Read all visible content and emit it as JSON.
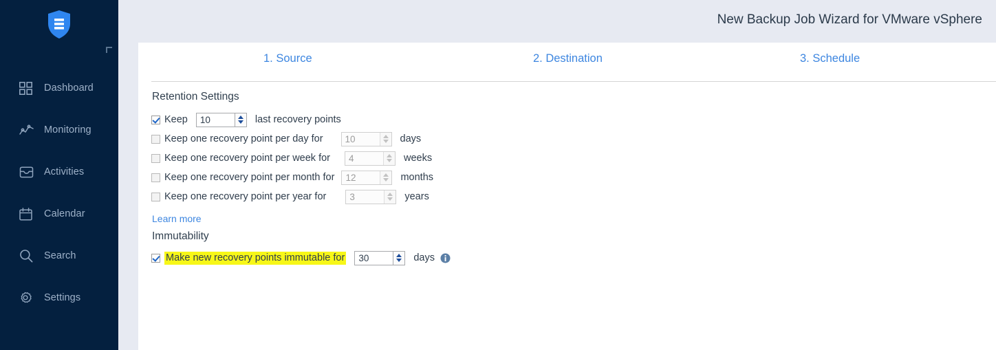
{
  "sidebar": {
    "logo_name": "shield-logo",
    "items": [
      {
        "label": "Dashboard",
        "icon": "grid-icon"
      },
      {
        "label": "Monitoring",
        "icon": "activity-chart-icon"
      },
      {
        "label": "Activities",
        "icon": "inbox-icon"
      },
      {
        "label": "Calendar",
        "icon": "calendar-icon"
      },
      {
        "label": "Search",
        "icon": "search-icon"
      },
      {
        "label": "Settings",
        "icon": "gear-icon"
      }
    ]
  },
  "header": {
    "title": "New Backup Job Wizard for VMware vSphere"
  },
  "tabs": [
    {
      "label": "1. Source"
    },
    {
      "label": "2. Destination"
    },
    {
      "label": "3. Schedule"
    }
  ],
  "retention": {
    "section_title": "Retention Settings",
    "keep_row": {
      "checked": true,
      "label": "Keep",
      "value": "10",
      "unit": "last recovery points"
    },
    "rows": [
      {
        "checked": false,
        "label": "Keep one recovery point per day for",
        "value": "10",
        "unit": "days"
      },
      {
        "checked": false,
        "label": "Keep one recovery point per week for",
        "value": "4",
        "unit": "weeks"
      },
      {
        "checked": false,
        "label": "Keep one recovery point per month for",
        "value": "12",
        "unit": "months"
      },
      {
        "checked": false,
        "label": "Keep one recovery point per year for",
        "value": "3",
        "unit": "years"
      }
    ],
    "learn_more": "Learn more"
  },
  "immutability": {
    "section_title": "Immutability",
    "checked": true,
    "label": "Make new recovery points immutable for",
    "value": "30",
    "unit": "days",
    "info_icon": "info-icon",
    "highlight_color": "#f7f718"
  },
  "colors": {
    "sidebar_bg": "#04203f",
    "page_bg": "#e7eaf2",
    "panel_bg": "#ffffff",
    "link": "#3d86e0",
    "accent": "#1f66c7"
  }
}
